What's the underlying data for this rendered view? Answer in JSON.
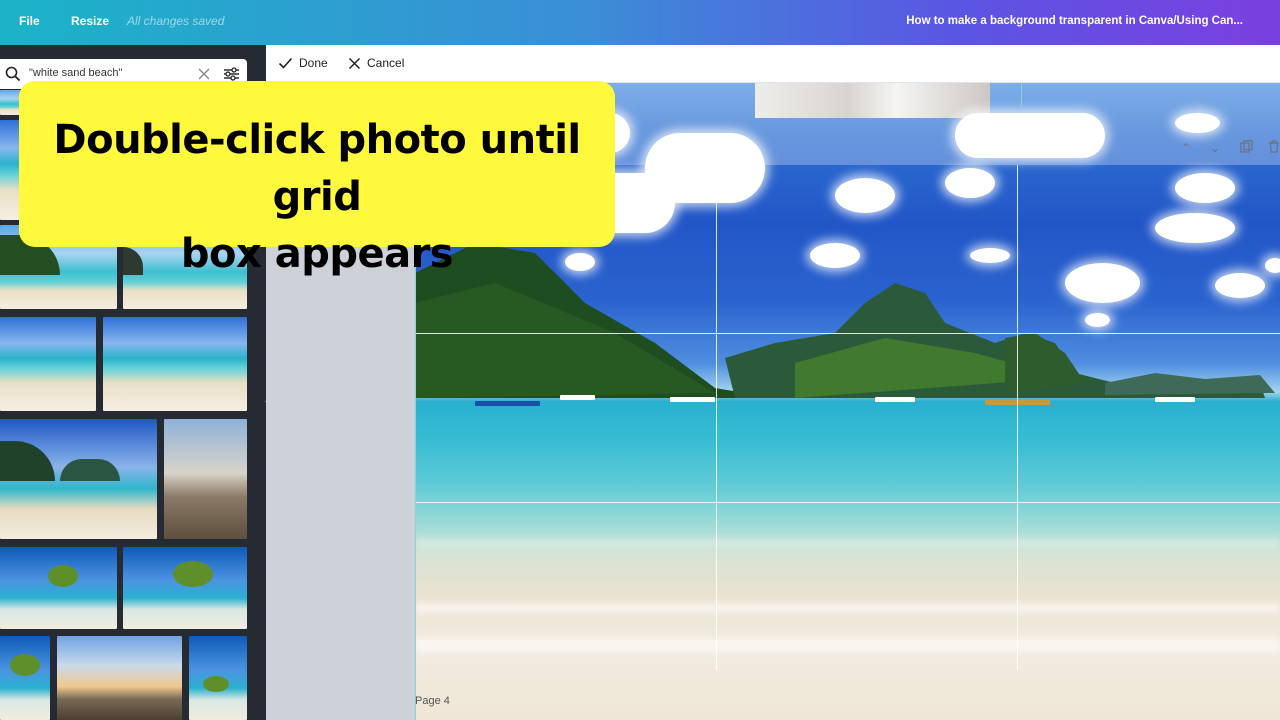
{
  "topbar": {
    "file_label": "File",
    "resize_label": "Resize",
    "save_status": "All changes saved",
    "document_title": "How to make a background transparent in Canva/Using Can..."
  },
  "left_panel": {
    "search": {
      "value": "\"white sand beach\"",
      "search_icon": "search-icon",
      "clear_icon": "close-icon",
      "filter_icon": "filter-sliders-icon"
    },
    "collapse_icon": "chevron-left-icon"
  },
  "edit_toolbar": {
    "done_label": "Done",
    "cancel_label": "Cancel",
    "done_icon": "check-icon",
    "cancel_icon": "close-icon"
  },
  "canvas": {
    "page_label": "Page 4",
    "controls": [
      "chevron-up-icon",
      "chevron-down-icon",
      "duplicate-icon",
      "trash-icon"
    ]
  },
  "callout": {
    "line1": "Double-click photo until grid",
    "line2": "box appears"
  },
  "colors": {
    "callout_bg": "#fff93e",
    "sidebar_bg": "#252a33"
  }
}
